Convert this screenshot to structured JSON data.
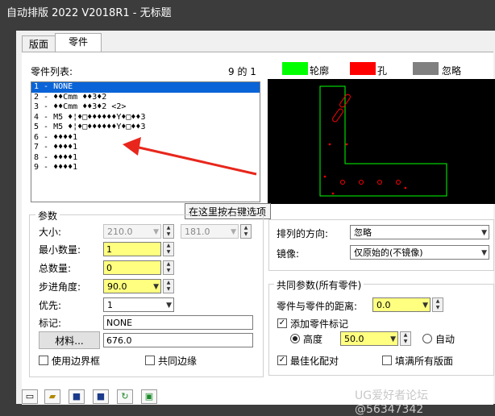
{
  "window": {
    "title": "自动排版 2022 V2018R1 - 无标题"
  },
  "tabs": [
    {
      "label": "版面"
    },
    {
      "label": "零件"
    }
  ],
  "parts": {
    "label": "零件列表:",
    "count": "9 的 1",
    "items": [
      "1 - NONE",
      "2 - ♦♦Cmm ♦♦3♦2",
      "3 - ♦♦Cmm ♦♦3♦2 <2>",
      "4 - M5 ♦¦♦□♦♦♦♦♦♦Y♦□♦♦3",
      "5 - M5 ♦¦♦□♦♦♦♦♦♦Y♦□♦♦3",
      "6 - ♦♦♦♦1",
      "7 - ♦♦♦♦1",
      "8 - ♦♦♦♦1",
      "9 - ♦♦♦♦1"
    ],
    "selected_index": 0
  },
  "legend": [
    {
      "label": "轮廓",
      "color": "#00ff00"
    },
    {
      "label": "孔",
      "color": "#ff0000"
    },
    {
      "label": "忽略",
      "color": "#808080"
    }
  ],
  "tooltip": "在这里按右键选项",
  "params": {
    "group_label": "参数",
    "size_label": "大小:",
    "size_w": "210.0",
    "size_h": "181.0",
    "min_qty_label": "最小数量:",
    "min_qty": "1",
    "total_qty_label": "总数量:",
    "total_qty": "0",
    "step_angle_label": "步进角度:",
    "step_angle": "90.0",
    "priority_label": "优先:",
    "priority": "1",
    "mark_label": "标记:",
    "mark": "NONE",
    "material_button": "材料...",
    "material_value": "676.0",
    "use_border_label": "使用边界框",
    "common_edge_label": "共同边缘"
  },
  "orientation": {
    "direction_label": "排列的方向:",
    "direction_value": "忽略",
    "mirror_label": "镜像:",
    "mirror_value": "仅原始的(不镜像)"
  },
  "common": {
    "group_label": "共同参数(所有零件)",
    "distance_label": "零件与零件的距离:",
    "distance": "0.0",
    "add_mark_label": "添加零件标记",
    "height_label": "高度",
    "height_value": "50.0",
    "auto_label": "自动",
    "best_fit_label": "最佳化配对",
    "fill_all_label": "填满所有版面"
  },
  "watermark": "UG爱好者论坛@56347342",
  "toolbar_icons": [
    "new-file-icon",
    "open-file-icon",
    "save-icon",
    "save-all-icon",
    "refresh-icon",
    "export-icon"
  ]
}
